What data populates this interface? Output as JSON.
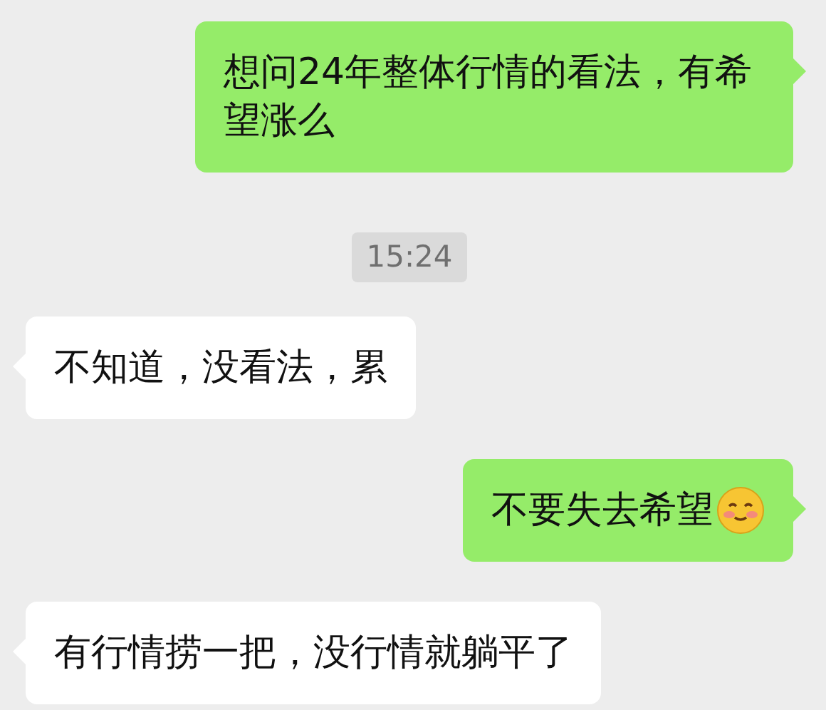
{
  "messages": [
    {
      "kind": "message",
      "outgoing": true,
      "text": "想问24年整体行情的看法，有希望涨么",
      "emoji": false
    },
    {
      "kind": "time",
      "text": "15:24"
    },
    {
      "kind": "message",
      "outgoing": false,
      "text": "不知道，没看法，累",
      "emoji": false
    },
    {
      "kind": "message",
      "outgoing": true,
      "text": "不要失去希望",
      "emoji": true
    },
    {
      "kind": "message",
      "outgoing": false,
      "text": "有行情捞一把，没行情就躺平了",
      "emoji": false
    }
  ]
}
